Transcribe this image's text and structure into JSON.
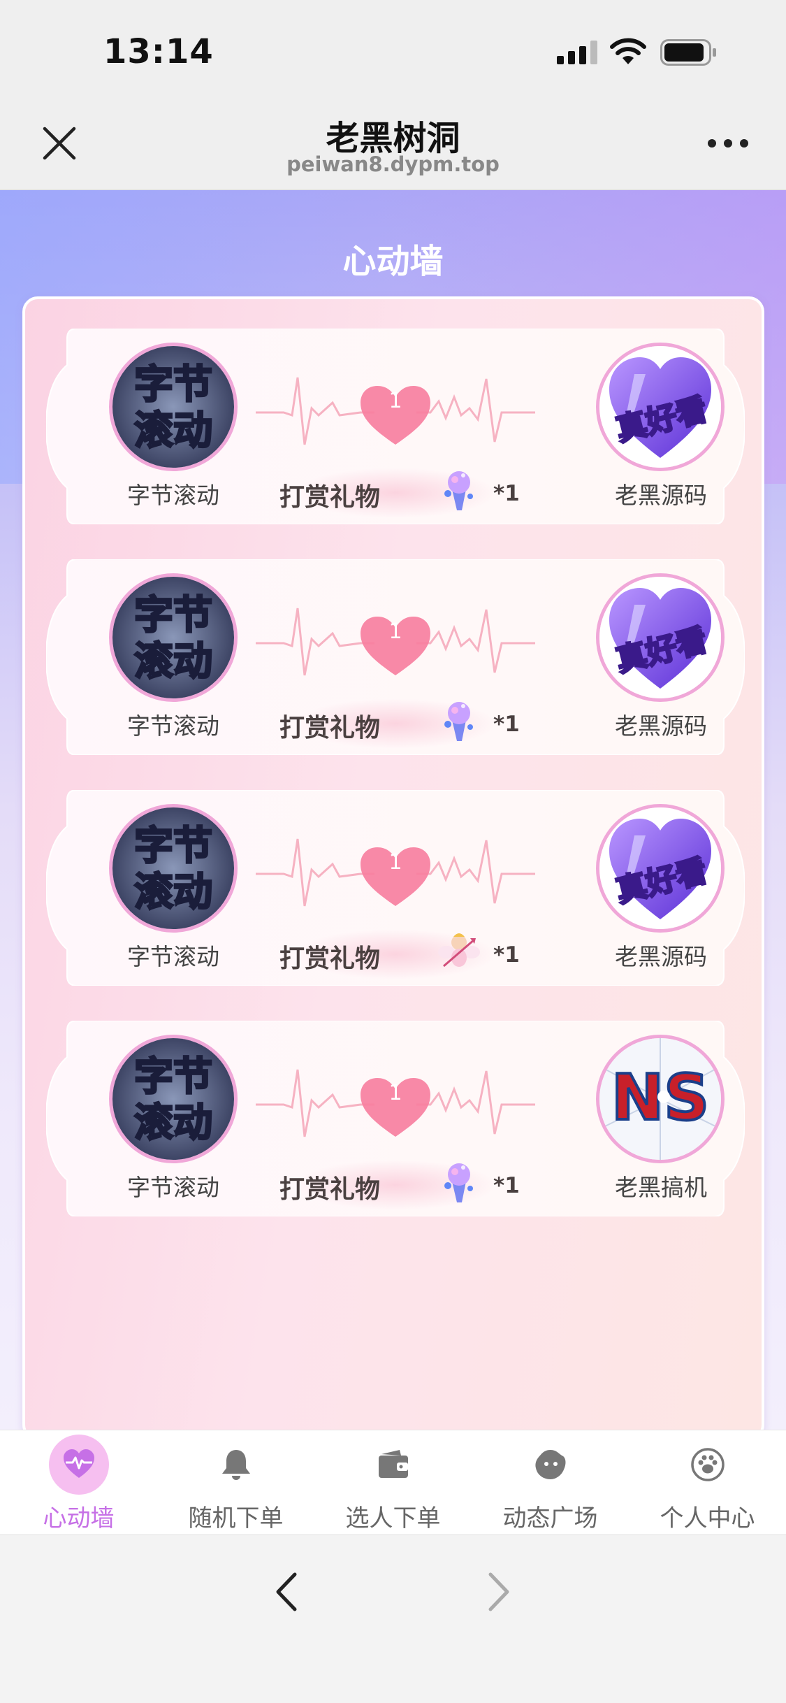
{
  "status_bar": {
    "time": "13:14",
    "signal_icon": "signal-bars-icon",
    "wifi_icon": "wifi-icon",
    "battery_icon": "battery-icon"
  },
  "nav": {
    "title": "老黑树洞",
    "url": "peiwan8.dypm.top",
    "close_icon": "close-icon",
    "more_icon": "more-icon"
  },
  "page": {
    "title": "心动墙"
  },
  "records": [
    {
      "from_name": "字节滚动",
      "from_avatar_text": [
        "字节",
        "滚动"
      ],
      "to_name": "老黑源码",
      "to_avatar_text": "真好看",
      "heart_count": "1",
      "gift_label": "打赏礼物",
      "gift_icon": "ice-cream-gift-icon",
      "gift_qty": "*1"
    },
    {
      "from_name": "字节滚动",
      "from_avatar_text": [
        "字节",
        "滚动"
      ],
      "to_name": "老黑源码",
      "to_avatar_text": "真好看",
      "heart_count": "1",
      "gift_label": "打赏礼物",
      "gift_icon": "ice-cream-gift-icon",
      "gift_qty": "*1"
    },
    {
      "from_name": "字节滚动",
      "from_avatar_text": [
        "字节",
        "滚动"
      ],
      "to_name": "老黑源码",
      "to_avatar_text": "真好看",
      "heart_count": "1",
      "gift_label": "打赏礼物",
      "gift_icon": "cupid-gift-icon",
      "gift_qty": "*1"
    },
    {
      "from_name": "字节滚动",
      "from_avatar_text": [
        "字节",
        "滚动"
      ],
      "to_name": "老黑搞机",
      "to_avatar_text": "NS",
      "heart_count": "1",
      "gift_label": "打赏礼物",
      "gift_icon": "ice-cream-gift-icon",
      "gift_qty": "*1"
    }
  ],
  "tabs": [
    {
      "label": "心动墙",
      "icon": "heart-pulse-icon",
      "active": true
    },
    {
      "label": "随机下单",
      "icon": "bell-icon",
      "active": false
    },
    {
      "label": "选人下单",
      "icon": "wallet-icon",
      "active": false
    },
    {
      "label": "动态广场",
      "icon": "chat-blob-icon",
      "active": false
    },
    {
      "label": "个人中心",
      "icon": "paw-icon",
      "active": false
    }
  ],
  "browser": {
    "back_icon": "back-chevron-icon",
    "forward_icon": "forward-chevron-icon"
  },
  "colors": {
    "accent": "#c670e6",
    "avatar_border": "#f0a7d8",
    "heart": "#f77f9f"
  }
}
